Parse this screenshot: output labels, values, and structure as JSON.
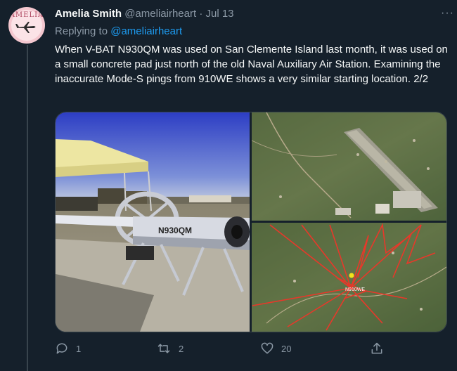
{
  "tweet": {
    "display_name": "Amelia Smith",
    "handle": "@ameliairheart",
    "separator": "·",
    "date": "Jul 13",
    "more": "···",
    "replying_prefix": "Replying to",
    "replying_handle": "@ameliairheart",
    "text": "When V-BAT N930QM was used on San Clemente Island last month, it was used on a small concrete pad just north of the old Naval Auxiliary Air Station. Examining the inaccurate Mode-S pings from 910WE shows a very similar starting location. 2/2"
  },
  "avatar": {
    "text": "AMELIA"
  },
  "media": {
    "photo_tail_number": "N930QM",
    "map_label": "N910WE"
  },
  "actions": {
    "replies": "1",
    "retweets": "2",
    "likes": "20"
  },
  "colors": {
    "background": "#15202b",
    "link": "#1d9bf0",
    "muted": "#8b98a5",
    "track": "#e8382a"
  }
}
